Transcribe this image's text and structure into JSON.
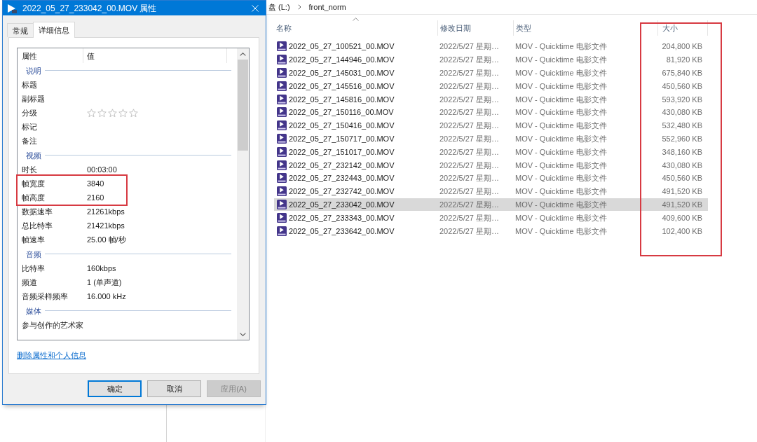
{
  "explorer": {
    "breadcrumb": [
      "盘 (L:)",
      "front_norm"
    ],
    "columns": [
      {
        "label": "名称",
        "sorted": true,
        "highlighted": false
      },
      {
        "label": "修改日期",
        "sorted": false,
        "highlighted": false
      },
      {
        "label": "类型",
        "sorted": false,
        "highlighted": false
      },
      {
        "label": "大小",
        "sorted": false,
        "highlighted": true
      }
    ],
    "files": [
      {
        "name": "2022_05_27_100521_00.MOV",
        "modified": "2022/5/27 星期…",
        "type": "MOV - Quicktime 电影文件",
        "size": "204,800 KB",
        "selected": false
      },
      {
        "name": "2022_05_27_144946_00.MOV",
        "modified": "2022/5/27 星期…",
        "type": "MOV - Quicktime 电影文件",
        "size": "81,920 KB",
        "selected": false
      },
      {
        "name": "2022_05_27_145031_00.MOV",
        "modified": "2022/5/27 星期…",
        "type": "MOV - Quicktime 电影文件",
        "size": "675,840 KB",
        "selected": false
      },
      {
        "name": "2022_05_27_145516_00.MOV",
        "modified": "2022/5/27 星期…",
        "type": "MOV - Quicktime 电影文件",
        "size": "450,560 KB",
        "selected": false
      },
      {
        "name": "2022_05_27_145816_00.MOV",
        "modified": "2022/5/27 星期…",
        "type": "MOV - Quicktime 电影文件",
        "size": "593,920 KB",
        "selected": false
      },
      {
        "name": "2022_05_27_150116_00.MOV",
        "modified": "2022/5/27 星期…",
        "type": "MOV - Quicktime 电影文件",
        "size": "430,080 KB",
        "selected": false
      },
      {
        "name": "2022_05_27_150416_00.MOV",
        "modified": "2022/5/27 星期…",
        "type": "MOV - Quicktime 电影文件",
        "size": "532,480 KB",
        "selected": false
      },
      {
        "name": "2022_05_27_150717_00.MOV",
        "modified": "2022/5/27 星期…",
        "type": "MOV - Quicktime 电影文件",
        "size": "552,960 KB",
        "selected": false
      },
      {
        "name": "2022_05_27_151017_00.MOV",
        "modified": "2022/5/27 星期…",
        "type": "MOV - Quicktime 电影文件",
        "size": "348,160 KB",
        "selected": false
      },
      {
        "name": "2022_05_27_232142_00.MOV",
        "modified": "2022/5/27 星期…",
        "type": "MOV - Quicktime 电影文件",
        "size": "430,080 KB",
        "selected": false
      },
      {
        "name": "2022_05_27_232443_00.MOV",
        "modified": "2022/5/27 星期…",
        "type": "MOV - Quicktime 电影文件",
        "size": "450,560 KB",
        "selected": false
      },
      {
        "name": "2022_05_27_232742_00.MOV",
        "modified": "2022/5/27 星期…",
        "type": "MOV - Quicktime 电影文件",
        "size": "491,520 KB",
        "selected": false
      },
      {
        "name": "2022_05_27_233042_00.MOV",
        "modified": "2022/5/27 星期…",
        "type": "MOV - Quicktime 电影文件",
        "size": "491,520 KB",
        "selected": true
      },
      {
        "name": "2022_05_27_233343_00.MOV",
        "modified": "2022/5/27 星期…",
        "type": "MOV - Quicktime 电影文件",
        "size": "409,600 KB",
        "selected": false
      },
      {
        "name": "2022_05_27_233642_00.MOV",
        "modified": "2022/5/27 星期…",
        "type": "MOV - Quicktime 电影文件",
        "size": "102,400 KB",
        "selected": false
      }
    ]
  },
  "dialog": {
    "title": "2022_05_27_233042_00.MOV 属性",
    "tabs": [
      {
        "label": "常规",
        "selected": false
      },
      {
        "label": "详细信息",
        "selected": true
      }
    ],
    "columns": [
      "属性",
      "值"
    ],
    "groups": [
      {
        "name": "说明",
        "rows": [
          {
            "label": "标题",
            "kind": "text",
            "highlighted": false
          },
          {
            "label": "副标题",
            "kind": "text",
            "highlighted": false
          },
          {
            "label": "分级",
            "kind": "stars",
            "stars": 0,
            "highlighted": false
          },
          {
            "label": "标记",
            "kind": "text",
            "highlighted": false
          },
          {
            "label": "备注",
            "kind": "text",
            "highlighted": false
          }
        ]
      },
      {
        "name": "视频",
        "rows": [
          {
            "label": "时长",
            "kind": "text",
            "value": "00:03:00",
            "highlighted": false
          },
          {
            "label": "帧宽度",
            "kind": "text",
            "value": "3840",
            "highlighted": true
          },
          {
            "label": "帧高度",
            "kind": "text",
            "value": "2160",
            "highlighted": true
          },
          {
            "label": "数据速率",
            "kind": "text",
            "value": "21261kbps",
            "highlighted": false
          },
          {
            "label": "总比特率",
            "kind": "text",
            "value": "21421kbps",
            "highlighted": false
          },
          {
            "label": "帧速率",
            "kind": "text",
            "value": "25.00 帧/秒",
            "highlighted": false
          }
        ]
      },
      {
        "name": "音频",
        "rows": [
          {
            "label": "比特率",
            "kind": "text",
            "value": "160kbps",
            "highlighted": false
          },
          {
            "label": "频道",
            "kind": "text",
            "value": "1 (单声道)",
            "highlighted": false
          },
          {
            "label": "音频采样频率",
            "kind": "text",
            "value": "16.000 kHz",
            "highlighted": false
          }
        ]
      },
      {
        "name": "媒体",
        "rows": [
          {
            "label": "参与创作的艺术家",
            "kind": "text",
            "highlighted": false
          }
        ]
      }
    ],
    "link": "删除属性和个人信息",
    "buttons": [
      {
        "label": "确定",
        "default": true,
        "disabled": false
      },
      {
        "label": "取消",
        "default": false,
        "disabled": false
      },
      {
        "label": "应用(A)",
        "default": false,
        "disabled": true
      }
    ]
  }
}
